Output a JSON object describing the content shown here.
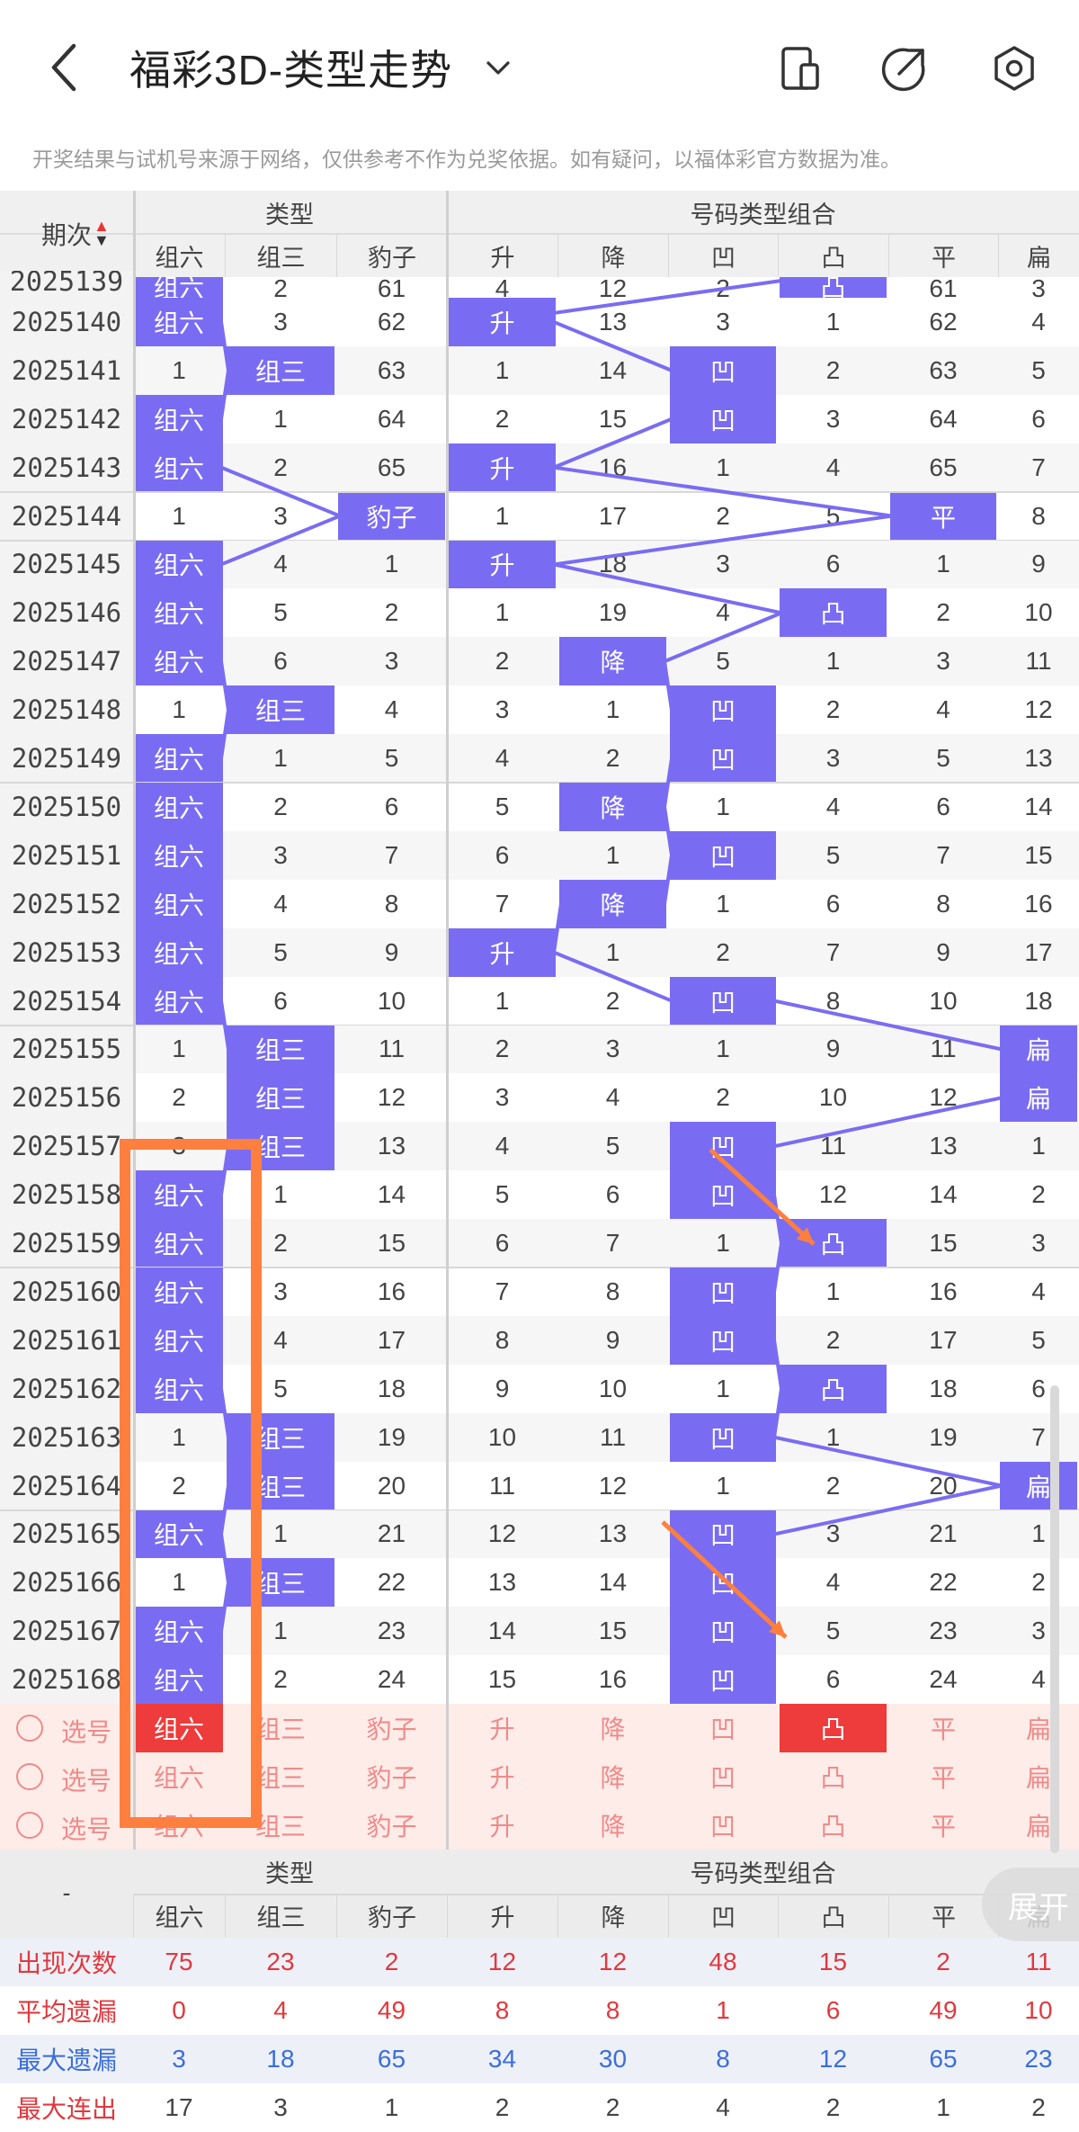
{
  "header": {
    "title": "福彩3D-类型走势",
    "back_icon": "back-arrow-icon",
    "dropdown_icon": "chevron-down-icon",
    "actions": [
      "phone-icon",
      "share-icon",
      "settings-icon"
    ]
  },
  "notice": "开奖结果与试机号来源于网络，仅供参考不作为兑奖依据。如有疑问，以福体彩官方数据为准。",
  "table": {
    "period_header": "期次",
    "group1_header": "类型",
    "group2_header": "号码类型组合",
    "columns": [
      "组六",
      "组三",
      "豹子",
      "升",
      "降",
      "凹",
      "凸",
      "平",
      "扁"
    ],
    "partial_row": {
      "period": "2025139",
      "values": [
        "组六",
        "2",
        "61",
        "4",
        "12",
        "2",
        "凸",
        "61",
        "3"
      ]
    },
    "rows": [
      {
        "period": "2025140",
        "values": [
          "组六",
          "3",
          "62",
          "升",
          "13",
          "3",
          "1",
          "62",
          "4"
        ]
      },
      {
        "period": "2025141",
        "values": [
          "1",
          "组三",
          "63",
          "1",
          "14",
          "凹",
          "2",
          "63",
          "5"
        ]
      },
      {
        "period": "2025142",
        "values": [
          "组六",
          "1",
          "64",
          "2",
          "15",
          "凹",
          "3",
          "64",
          "6"
        ]
      },
      {
        "period": "2025143",
        "values": [
          "组六",
          "2",
          "65",
          "升",
          "16",
          "1",
          "4",
          "65",
          "7"
        ]
      },
      {
        "period": "2025144",
        "values": [
          "1",
          "3",
          "豹子",
          "1",
          "17",
          "2",
          "5",
          "平",
          "8"
        ]
      },
      {
        "period": "2025145",
        "values": [
          "组六",
          "4",
          "1",
          "升",
          "18",
          "3",
          "6",
          "1",
          "9"
        ]
      },
      {
        "period": "2025146",
        "values": [
          "组六",
          "5",
          "2",
          "1",
          "19",
          "4",
          "凸",
          "2",
          "10"
        ]
      },
      {
        "period": "2025147",
        "values": [
          "组六",
          "6",
          "3",
          "2",
          "降",
          "5",
          "1",
          "3",
          "11"
        ]
      },
      {
        "period": "2025148",
        "values": [
          "1",
          "组三",
          "4",
          "3",
          "1",
          "凹",
          "2",
          "4",
          "12"
        ]
      },
      {
        "period": "2025149",
        "values": [
          "组六",
          "1",
          "5",
          "4",
          "2",
          "凹",
          "3",
          "5",
          "13"
        ]
      },
      {
        "period": "2025150",
        "values": [
          "组六",
          "2",
          "6",
          "5",
          "降",
          "1",
          "4",
          "6",
          "14"
        ]
      },
      {
        "period": "2025151",
        "values": [
          "组六",
          "3",
          "7",
          "6",
          "1",
          "凹",
          "5",
          "7",
          "15"
        ]
      },
      {
        "period": "2025152",
        "values": [
          "组六",
          "4",
          "8",
          "7",
          "降",
          "1",
          "6",
          "8",
          "16"
        ]
      },
      {
        "period": "2025153",
        "values": [
          "组六",
          "5",
          "9",
          "升",
          "1",
          "2",
          "7",
          "9",
          "17"
        ]
      },
      {
        "period": "2025154",
        "values": [
          "组六",
          "6",
          "10",
          "1",
          "2",
          "凹",
          "8",
          "10",
          "18"
        ]
      },
      {
        "period": "2025155",
        "values": [
          "1",
          "组三",
          "11",
          "2",
          "3",
          "1",
          "9",
          "11",
          "扁"
        ]
      },
      {
        "period": "2025156",
        "values": [
          "2",
          "组三",
          "12",
          "3",
          "4",
          "2",
          "10",
          "12",
          "扁"
        ]
      },
      {
        "period": "2025157",
        "values": [
          "3",
          "组三",
          "13",
          "4",
          "5",
          "凹",
          "11",
          "13",
          "1"
        ]
      },
      {
        "period": "2025158",
        "values": [
          "组六",
          "1",
          "14",
          "5",
          "6",
          "凹",
          "12",
          "14",
          "2"
        ]
      },
      {
        "period": "2025159",
        "values": [
          "组六",
          "2",
          "15",
          "6",
          "7",
          "1",
          "凸",
          "15",
          "3"
        ]
      },
      {
        "period": "2025160",
        "values": [
          "组六",
          "3",
          "16",
          "7",
          "8",
          "凹",
          "1",
          "16",
          "4"
        ]
      },
      {
        "period": "2025161",
        "values": [
          "组六",
          "4",
          "17",
          "8",
          "9",
          "凹",
          "2",
          "17",
          "5"
        ]
      },
      {
        "period": "2025162",
        "values": [
          "组六",
          "5",
          "18",
          "9",
          "10",
          "1",
          "凸",
          "18",
          "6"
        ]
      },
      {
        "period": "2025163",
        "values": [
          "1",
          "组三",
          "19",
          "10",
          "11",
          "凹",
          "1",
          "19",
          "7"
        ]
      },
      {
        "period": "2025164",
        "values": [
          "2",
          "组三",
          "20",
          "11",
          "12",
          "1",
          "2",
          "20",
          "扁"
        ]
      },
      {
        "period": "2025165",
        "values": [
          "组六",
          "1",
          "21",
          "12",
          "13",
          "凹",
          "3",
          "21",
          "1"
        ]
      },
      {
        "period": "2025166",
        "values": [
          "1",
          "组三",
          "22",
          "13",
          "14",
          "凹",
          "4",
          "22",
          "2"
        ]
      },
      {
        "period": "2025167",
        "values": [
          "组六",
          "1",
          "23",
          "14",
          "15",
          "凹",
          "5",
          "23",
          "3"
        ]
      },
      {
        "period": "2025168",
        "values": [
          "组六",
          "2",
          "24",
          "15",
          "16",
          "凹",
          "6",
          "24",
          "4"
        ]
      }
    ],
    "select_label": "选号",
    "select_rows": [
      {
        "selected": [
          0,
          6
        ]
      },
      {
        "selected": []
      },
      {
        "selected": []
      }
    ]
  },
  "footer": {
    "dash": "-",
    "stat_labels": [
      "出现次数",
      "平均遗漏",
      "最大遗漏",
      "最大连出"
    ],
    "stat_colors": [
      "#e0393e",
      "#e0393e",
      "#3a6fd8",
      "#e0393e"
    ],
    "stats": [
      [
        "75",
        "23",
        "2",
        "12",
        "12",
        "48",
        "15",
        "2",
        "11"
      ],
      [
        "0",
        "4",
        "49",
        "8",
        "8",
        "1",
        "6",
        "49",
        "10"
      ],
      [
        "3",
        "18",
        "65",
        "34",
        "30",
        "8",
        "12",
        "65",
        "23"
      ],
      [
        "17",
        "3",
        "1",
        "2",
        "2",
        "4",
        "2",
        "1",
        "2"
      ]
    ],
    "stat_value_colors": [
      "#e0393e",
      "#e0393e",
      "#3a6fd8",
      "#444444"
    ]
  },
  "expand_label": "展开",
  "colors": {
    "accent": "#7a6cf2",
    "highlight_red": "#ee3b3b",
    "annotation_orange": "#ff7f3f"
  }
}
